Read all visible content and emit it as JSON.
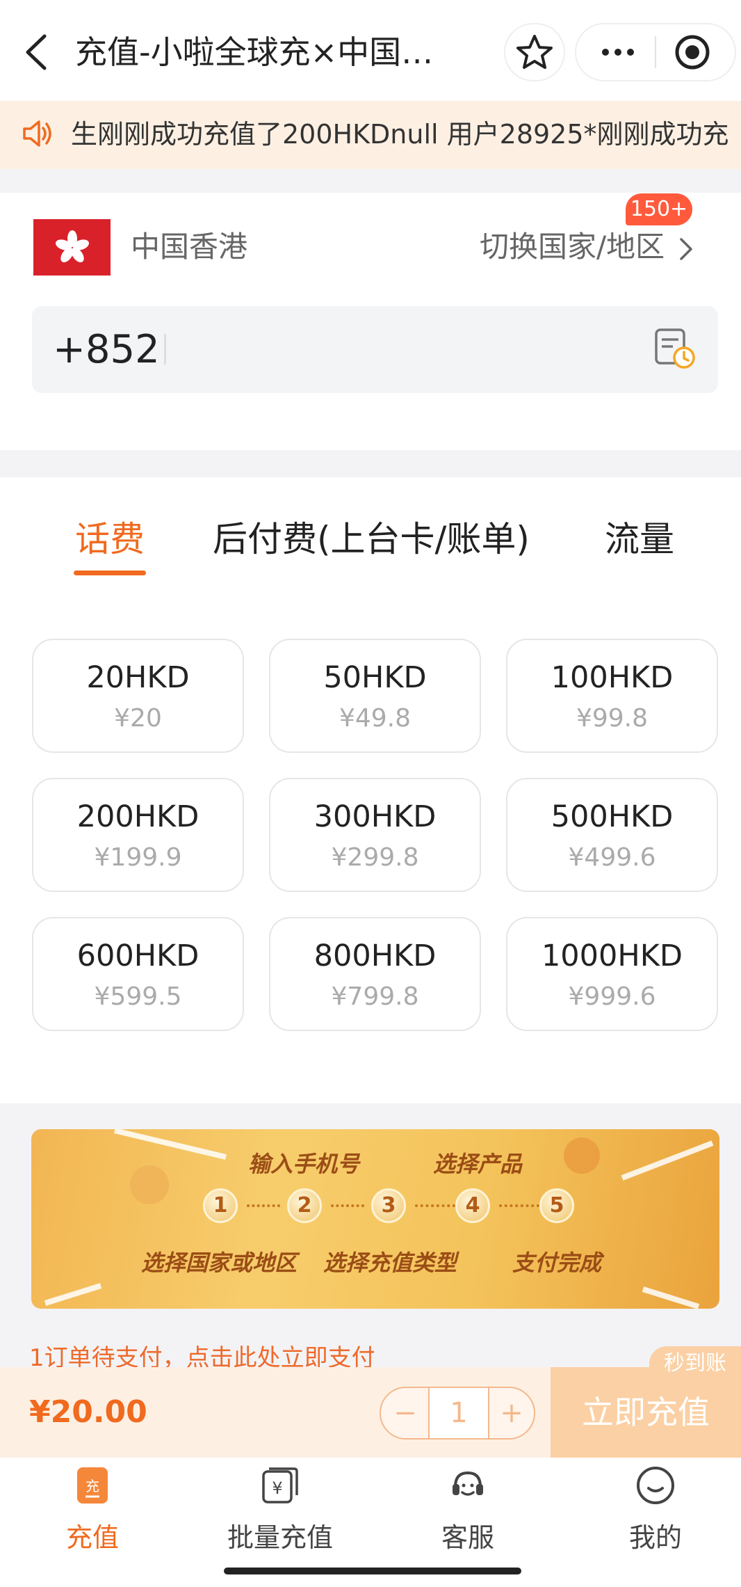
{
  "header": {
    "title": "充值-小啦全球充×中国…"
  },
  "notice": {
    "text": "生刚刚成功充值了200HKDnull 用户28925*刚刚成功充"
  },
  "region": {
    "name": "中国香港",
    "switch_label": "切换国家/地区",
    "badge": "150+"
  },
  "phone": {
    "prefix": "+852",
    "value": ""
  },
  "tabs": [
    {
      "label": "话费",
      "active": true
    },
    {
      "label": "后付费(上台卡/账单)"
    },
    {
      "label": "流量"
    }
  ],
  "products": [
    {
      "name": "20HKD",
      "price": "¥20"
    },
    {
      "name": "50HKD",
      "price": "¥49.8"
    },
    {
      "name": "100HKD",
      "price": "¥99.8"
    },
    {
      "name": "200HKD",
      "price": "¥199.9"
    },
    {
      "name": "300HKD",
      "price": "¥299.8"
    },
    {
      "name": "500HKD",
      "price": "¥499.6"
    },
    {
      "name": "600HKD",
      "price": "¥599.5"
    },
    {
      "name": "800HKD",
      "price": "¥799.8"
    },
    {
      "name": "1000HKD",
      "price": "¥999.6"
    }
  ],
  "banner": {
    "top_labels": [
      "输入手机号",
      "选择产品"
    ],
    "bottom_labels": [
      "选择国家或地区",
      "选择充值类型",
      "支付完成"
    ],
    "steps": [
      "1",
      "2",
      "3",
      "4",
      "5"
    ]
  },
  "pending": {
    "text": "1订单待支付，点击此处立即支付"
  },
  "bottom_bar": {
    "price": "¥20.00",
    "minus": "−",
    "quantity": "1",
    "plus": "+",
    "buy_label": "立即充值",
    "fast_badge": "秒到账"
  },
  "nav": [
    {
      "label": "充值",
      "icon": "recharge-icon",
      "active": true
    },
    {
      "label": "批量充值",
      "icon": "batch-recharge-icon"
    },
    {
      "label": "客服",
      "icon": "customer-service-icon"
    },
    {
      "label": "我的",
      "icon": "profile-icon"
    }
  ],
  "colors": {
    "accent": "#f06a1f",
    "button_disabled": "#fbd0a4",
    "notice_bg": "#fdf0e3"
  }
}
